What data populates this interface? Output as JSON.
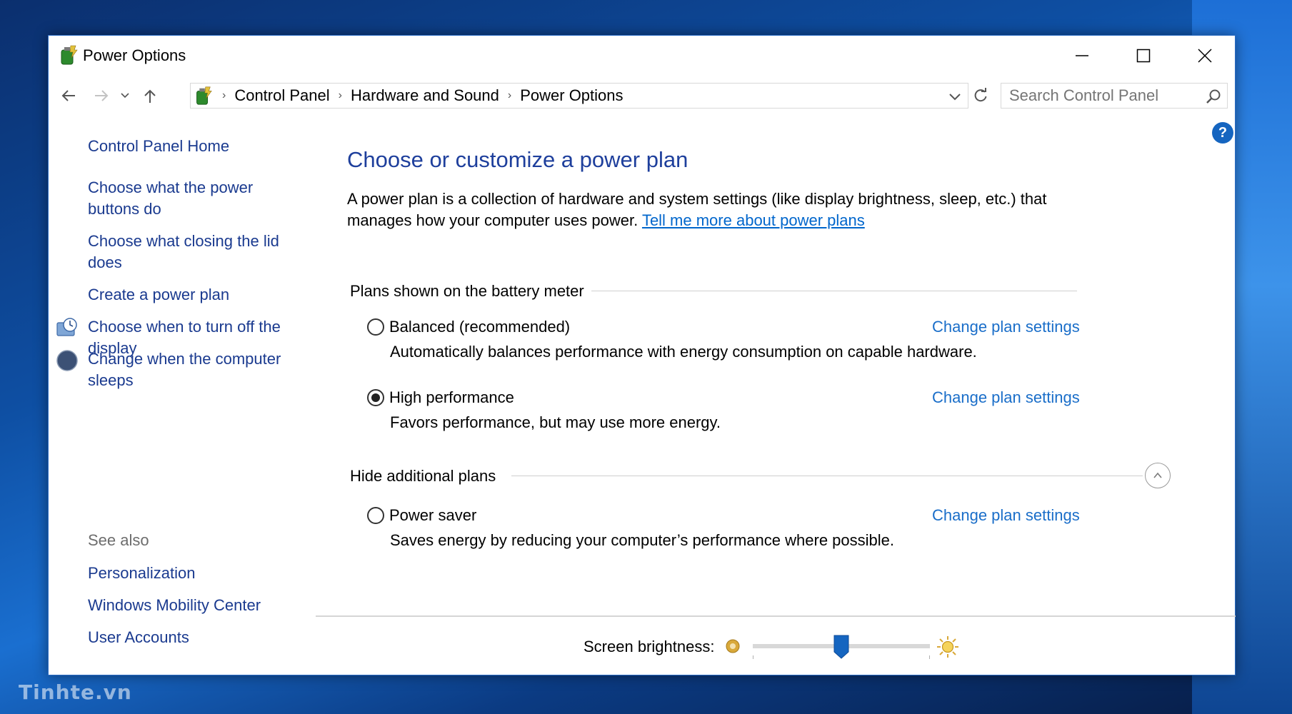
{
  "watermark": "Tinhte.vn",
  "window": {
    "title": "Power Options",
    "controls": {
      "minimize": "minimize-icon",
      "maximize": "maximize-icon",
      "close": "close-icon"
    }
  },
  "navigation": {
    "back": "back-arrow-icon",
    "forward": "forward-arrow-icon",
    "recent": "chevron-down-icon",
    "up": "up-arrow-icon",
    "breadcrumb": [
      "Control Panel",
      "Hardware and Sound",
      "Power Options"
    ],
    "search": {
      "placeholder": "Search Control Panel",
      "value": ""
    }
  },
  "sidebar": {
    "home": "Control Panel Home",
    "tasks": [
      {
        "label": "Choose what the power buttons do"
      },
      {
        "label": "Choose what closing the lid does"
      },
      {
        "label": "Create a power plan"
      },
      {
        "label": "Choose when to turn off the display",
        "icon": "display-clock-icon"
      },
      {
        "label": "Change when the computer sleeps",
        "icon": "moon-sleep-icon"
      }
    ],
    "see_also_heading": "See also",
    "see_also": [
      "Personalization",
      "Windows Mobility Center",
      "User Accounts"
    ]
  },
  "main": {
    "title": "Choose or customize a power plan",
    "intro": "A power plan is a collection of hardware and system settings (like display brightness, sleep, etc.) that manages how your computer uses power.",
    "intro_link": "Tell me more about power plans",
    "battery_group": "Plans shown on the battery meter",
    "additional_group": "Hide additional plans",
    "plans": [
      {
        "name": "Balanced (recommended)",
        "description": "Automatically balances performance with energy consumption on capable hardware.",
        "selected": false,
        "link": "Change plan settings"
      },
      {
        "name": "High performance",
        "description": "Favors performance, but may use more energy.",
        "selected": true,
        "link": "Change plan settings"
      },
      {
        "name": "Power saver",
        "description": "Saves energy by reducing your computer’s performance where possible.",
        "selected": false,
        "link": "Change plan settings"
      }
    ]
  },
  "brightness": {
    "label": "Screen brightness:",
    "level": 0.5
  },
  "colors": {
    "accent": "#1e3f9c",
    "link": "#1a6ec9",
    "thumb": "#1565c0"
  }
}
